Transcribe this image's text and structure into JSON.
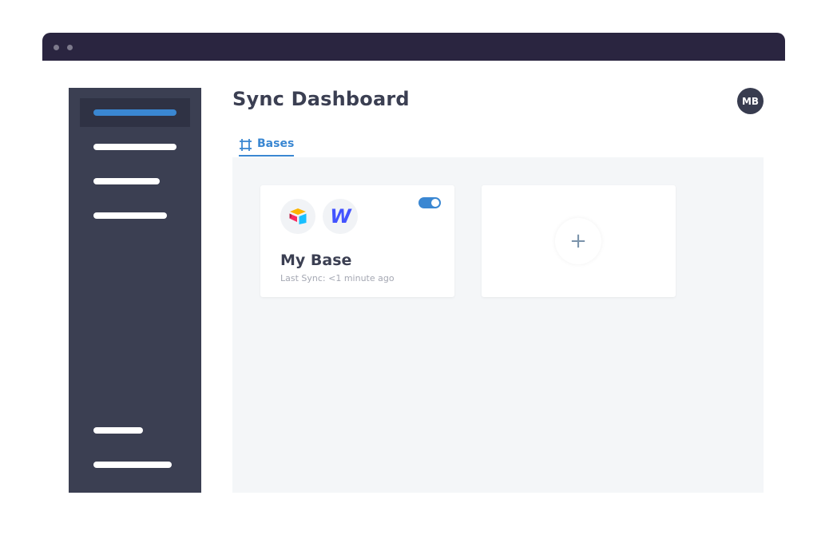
{
  "window": {
    "dots": [
      "window-dot",
      "window-dot"
    ]
  },
  "sidebar": {
    "items": [
      {
        "name": "sidebar-item-1",
        "active": true
      },
      {
        "name": "sidebar-item-2",
        "active": false
      },
      {
        "name": "sidebar-item-3",
        "active": false
      },
      {
        "name": "sidebar-item-4",
        "active": false
      },
      {
        "name": "sidebar-item-5",
        "active": false
      },
      {
        "name": "sidebar-item-6",
        "active": false
      }
    ]
  },
  "header": {
    "title": "Sync Dashboard",
    "avatar_initials": "MB"
  },
  "tabs": [
    {
      "label": "Bases",
      "icon": "frame-icon",
      "active": true
    }
  ],
  "bases": [
    {
      "name": "My Base",
      "last_sync": "Last Sync: <1 minute ago",
      "enabled": true,
      "apps": [
        "airtable-icon",
        "webflow-icon"
      ],
      "webflow_glyph": "W"
    }
  ],
  "add_card": {
    "icon": "plus-icon",
    "symbol": "+"
  },
  "colors": {
    "accent": "#3a87d2",
    "sidebar": "#3b3f52",
    "window_bar": "#2a2540",
    "content_bg": "#f4f6f8"
  }
}
